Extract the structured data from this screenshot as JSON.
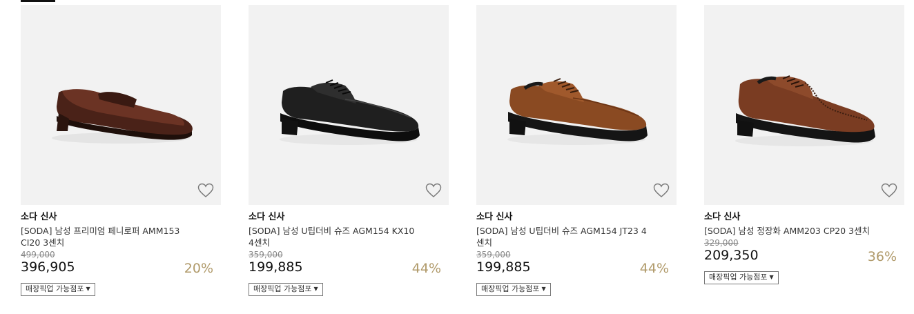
{
  "products": [
    {
      "brand": "소다 신사",
      "name": "[SODA] 남성 프리미엄 페니로퍼 AMM153 CI20 3센치",
      "original_price": "499,000",
      "sale_price": "396,905",
      "discount_rate": "20%",
      "pickup_label": "매장픽업 가능점포",
      "image": "brown-penny-loafer",
      "color": "#5a2b1e"
    },
    {
      "brand": "소다 신사",
      "name": "[SODA] 남성 U팁더비 슈즈 AGM154 KX10 4센치",
      "original_price": "359,000",
      "sale_price": "199,885",
      "discount_rate": "44%",
      "pickup_label": "매장픽업 가능점포",
      "image": "black-u-tip-derby",
      "color": "#1c1c1c"
    },
    {
      "brand": "소다 신사",
      "name": "[SODA] 남성 U팁더비 슈즈 AGM154 JT23 4센치",
      "original_price": "359,000",
      "sale_price": "199,885",
      "discount_rate": "44%",
      "pickup_label": "매장픽업 가능점포",
      "image": "tan-u-tip-derby",
      "color": "#8a4a22"
    },
    {
      "brand": "소다 신사",
      "name": "[SODA] 남성 정장화 AMM203 CP20 3센치",
      "original_price": "329,000",
      "sale_price": "209,350",
      "discount_rate": "36%",
      "pickup_label": "매장픽업 가능점포",
      "image": "brown-oxford-dress-shoe",
      "color": "#7a3c22"
    }
  ],
  "accent_color": "#b09a6a",
  "heart_icon": "heart-outline-icon"
}
